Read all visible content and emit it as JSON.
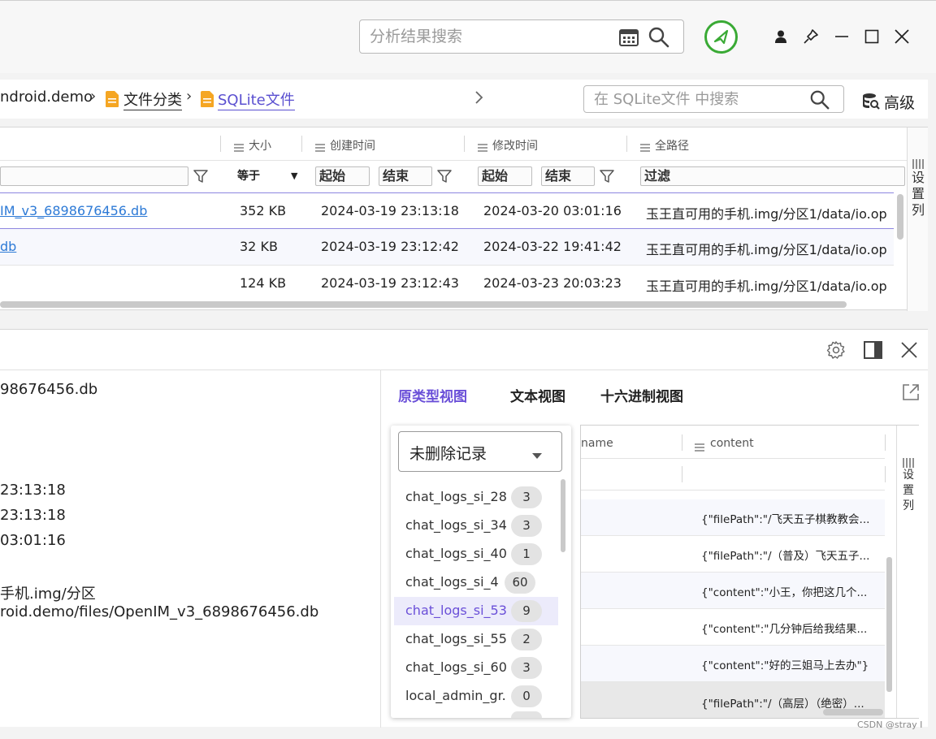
{
  "search": {
    "placeholder": "分析结果搜索"
  },
  "breadcrumb": {
    "items": [
      {
        "label": "ndroid.demo"
      },
      {
        "label": "文件分类"
      },
      {
        "label": "SQLite文件"
      }
    ],
    "separator": "›"
  },
  "folder_search": {
    "placeholder": "在 SQLite文件 中搜索"
  },
  "advanced_label": "高级",
  "file_table": {
    "columns": [
      {
        "label": "大小"
      },
      {
        "label": "创建时间"
      },
      {
        "label": "修改时间"
      },
      {
        "label": "全路径"
      }
    ],
    "filters": {
      "size_op": "等于",
      "start": "起始",
      "end": "结束",
      "path": "过滤"
    },
    "rows": [
      {
        "name": "IM_v3_6898676456.db",
        "size": "352 KB",
        "created": "2024-03-19 23:13:18",
        "modified": "2024-03-20 03:01:16",
        "path": "玉王直可用的手机.img/分区1/data/io.op"
      },
      {
        "name": "db",
        "size": "32 KB",
        "created": "2024-03-19 23:12:42",
        "modified": "2024-03-22 19:41:42",
        "path": "玉王直可用的手机.img/分区1/data/io.op"
      },
      {
        "name": "",
        "size": "124 KB",
        "created": "2024-03-19 23:12:43",
        "modified": "2024-03-23 20:03:23",
        "path": "玉王直可用的手机.img/分区1/data/io.op"
      }
    ],
    "settings_label": [
      "设",
      "置",
      "列"
    ]
  },
  "properties": {
    "filename": "98676456.db",
    "created": "23:13:18",
    "accessed": "23:13:18",
    "modified": "03:01:16",
    "path_line1": "手机.img/分区",
    "path_line2": "roid.demo/files/OpenIM_v3_6898676456.db"
  },
  "viewer": {
    "tabs": [
      {
        "label": "原类型视图",
        "active": true
      },
      {
        "label": "文本视图",
        "active": false
      },
      {
        "label": "十六进制视图",
        "active": false
      }
    ],
    "record_filter": "未删除记录",
    "tables": [
      {
        "name": "chat_logs_si_28...",
        "count": "3"
      },
      {
        "name": "chat_logs_si_34...",
        "count": "3"
      },
      {
        "name": "chat_logs_si_40...",
        "count": "1"
      },
      {
        "name": "chat_logs_si_4...",
        "count": "60"
      },
      {
        "name": "chat_logs_si_53...",
        "count": "9",
        "selected": true
      },
      {
        "name": "chat_logs_si_55...",
        "count": "2"
      },
      {
        "name": "chat_logs_si_60...",
        "count": "3"
      },
      {
        "name": "local_admin_gr...",
        "count": "0"
      }
    ],
    "grid": {
      "columns": [
        {
          "label": "name"
        },
        {
          "label": "content"
        }
      ],
      "rows": [
        {
          "content": "{\"filePath\":\"/飞天五子棋教教会..."
        },
        {
          "content": "{\"filePath\":\"/（普及）飞天五子..."
        },
        {
          "content": "{\"content\":\"小王，你把这几个..."
        },
        {
          "content": "{\"content\":\"几分钟后给我结果..."
        },
        {
          "content": "{\"content\":\"好的三姐马上去办\"}"
        },
        {
          "content": "{\"filePath\":\"/（高层）（绝密）..."
        }
      ],
      "settings_label": [
        "设",
        "置",
        "列"
      ]
    }
  },
  "watermark": "CSDN @stray I",
  "colors": {
    "accent": "#6a4fd8",
    "link": "#2d7ad6",
    "folder": "#f5a623",
    "ok_green": "#3aaa35"
  }
}
